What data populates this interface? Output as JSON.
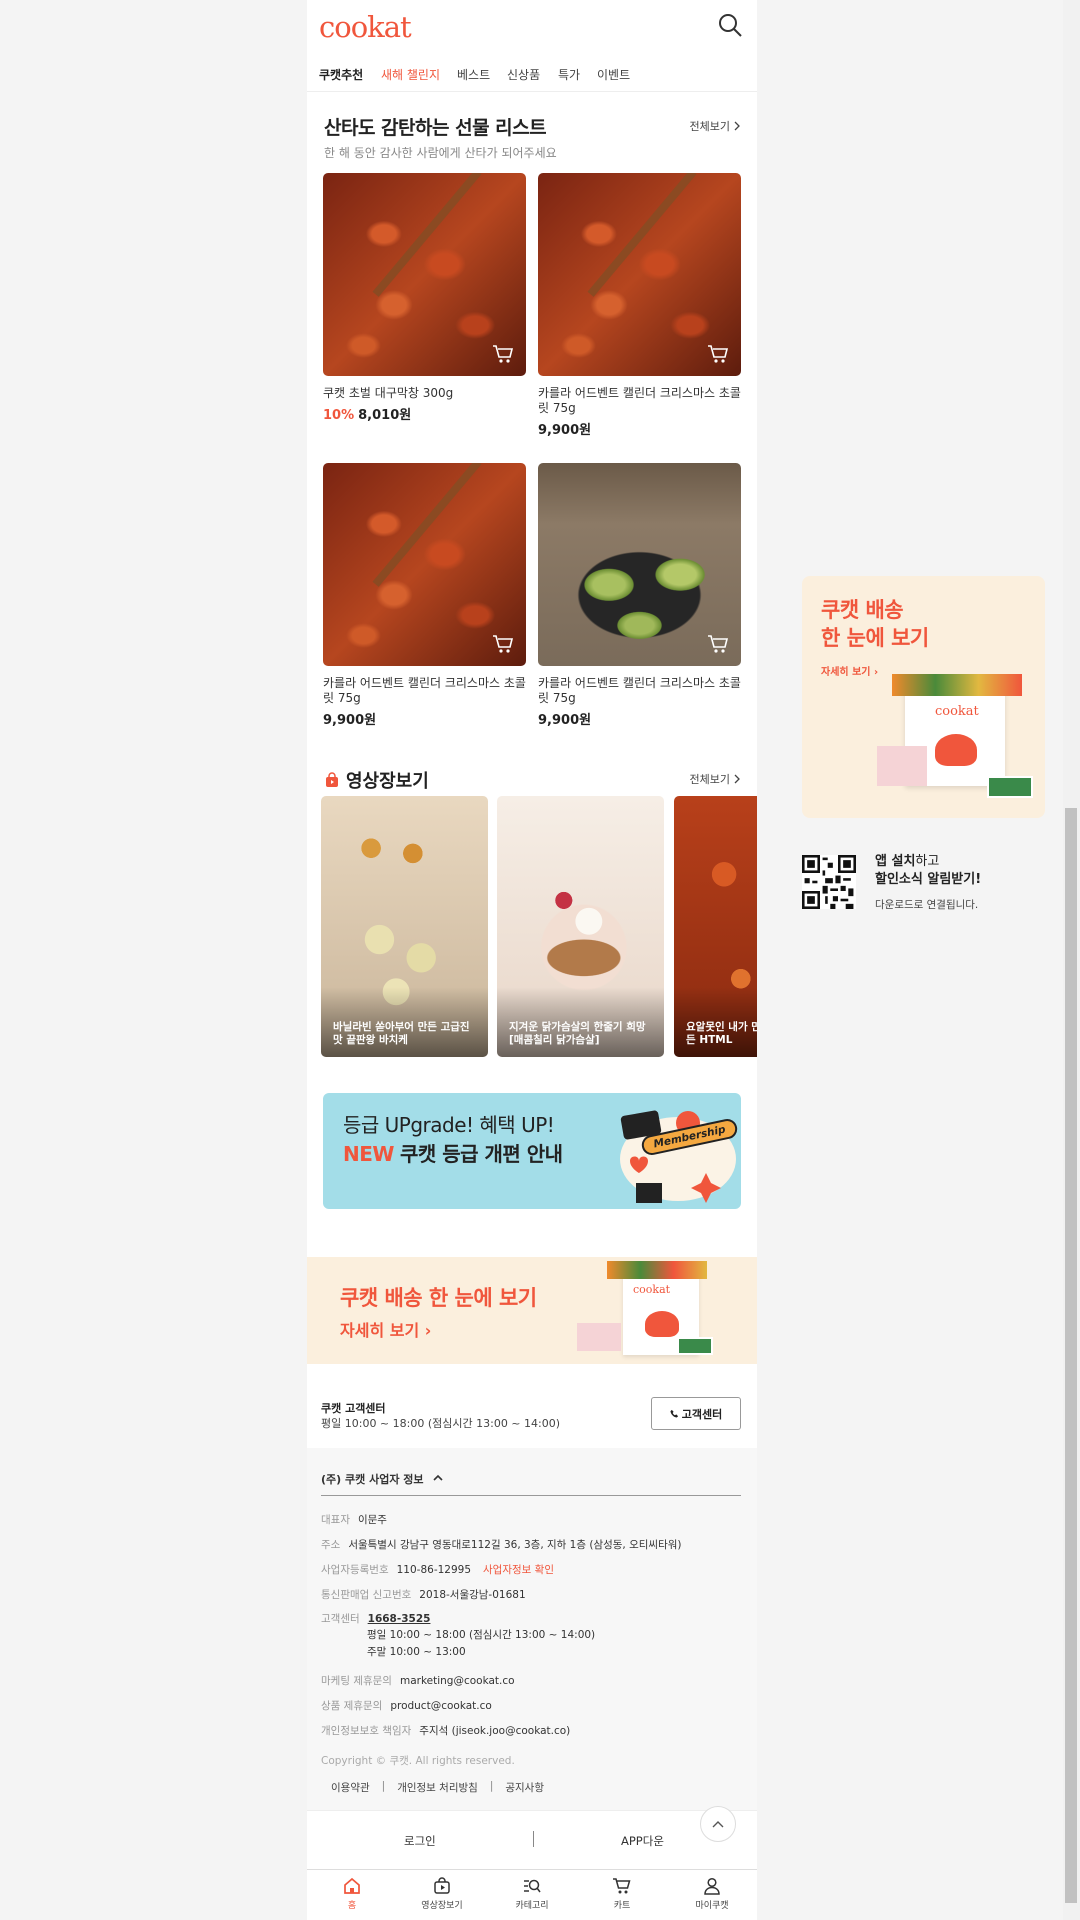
{
  "header": {
    "logo": "cookat"
  },
  "nav": [
    {
      "label": "쿠캣추천"
    },
    {
      "label": "새해 챌린지"
    },
    {
      "label": "베스트"
    },
    {
      "label": "신상품"
    },
    {
      "label": "특가"
    },
    {
      "label": "이벤트"
    }
  ],
  "gift_section": {
    "title": "산타도 감탄하는 선물 리스트",
    "subtitle": "한 해 동안 감사한 사람에게 산타가 되어주세요",
    "see_all": "전체보기",
    "products": [
      {
        "name": "쿠캣 초벌 대구막창 300g",
        "discount": "10%",
        "price": "8,010원"
      },
      {
        "name": "카를라 어드벤트 캘린더 크리스마스 초콜릿 75g",
        "discount": "",
        "price": "9,900원"
      },
      {
        "name": "카를라 어드벤트 캘린더 크리스마스 초콜릿 75g",
        "discount": "",
        "price": "9,900원"
      },
      {
        "name": "카를라 어드벤트 캘린더 크리스마스 초콜릿 75g",
        "discount": "",
        "price": "9,900원"
      }
    ]
  },
  "video_section": {
    "title": "영상장보기",
    "see_all": "전체보기",
    "videos": [
      {
        "caption": "바닐라빈 쏟아부어 만든 고급진 맛 끝판왕 바치케"
      },
      {
        "caption": "지겨운 닭가슴살의 한줄기 희망 [매콤칠리 닭가슴살]"
      },
      {
        "caption": "요알못인 내가 만든 HTML"
      }
    ]
  },
  "upgrade_banner": {
    "line1": "등급 UPgrade! 혜택 UP!",
    "new": "NEW",
    "line2": "쿠캣 등급 개편 안내",
    "badge": "Membership"
  },
  "delivery_banner": {
    "title": "쿠캣 배송 한 눈에 보기",
    "link": "자세히 보기"
  },
  "customer_center": {
    "title": "쿠캣 고객센터",
    "hours": "평일 10:00 ~ 18:00 (점심시간 13:00 ~ 14:00)",
    "button": "고객센터"
  },
  "business_info": {
    "header": "(주) 쿠캣 사업자 정보",
    "rows": [
      {
        "key": "대표자",
        "value": "이문주"
      },
      {
        "key": "주소",
        "value": "서울특별시 강남구 영동대로112길 36, 3층, 지하 1층 (삼성동, 오티씨타워)"
      },
      {
        "key": "사업자등록번호",
        "value": "110-86-12995",
        "link": "사업자정보 확인"
      },
      {
        "key": "통신판매업 신고번호",
        "value": "2018-서울강남-01681"
      },
      {
        "key": "고객센터",
        "value": "1668-3525",
        "hours1": "평일 10:00 ~ 18:00 (점심시간 13:00 ~ 14:00)",
        "hours2": "주말 10:00 ~ 13:00"
      },
      {
        "key": "마케팅 제휴문의",
        "value": "marketing@cookat.co"
      },
      {
        "key": "상품 제휴문의",
        "value": "product@cookat.co"
      },
      {
        "key": "개인정보보호 책임자",
        "value": "주지석 (jiseok.joo@cookat.co)"
      }
    ],
    "copyright": "Copyright © 쿠캣. All rights reserved.",
    "links": [
      "이용약관",
      "개인정보 처리방침",
      "공지사항"
    ]
  },
  "login_bar": {
    "login": "로그인",
    "app": "APP다운"
  },
  "tabbar": [
    {
      "label": "홈",
      "icon": "home-icon"
    },
    {
      "label": "영상장보기",
      "icon": "video-bag-icon"
    },
    {
      "label": "카테고리",
      "icon": "category-search-icon"
    },
    {
      "label": "카트",
      "icon": "cart-icon"
    },
    {
      "label": "마이쿠캣",
      "icon": "user-icon"
    }
  ],
  "side_ad": {
    "line1": "쿠캣 배송",
    "line2": "한 눈에 보기",
    "link": "자세히 보기",
    "box_logo": "cookat"
  },
  "app_promo": {
    "line1_bold": "앱 설치",
    "line1_rest": "하고",
    "line2_bold": "할인소식",
    "line2_rest": " 알림받기!",
    "sub": "다운로드로 연결됩니다."
  },
  "colors": {
    "brand": "#f0563c",
    "banner_blue": "#a3dde8",
    "banner_cream": "#fbefdd"
  }
}
